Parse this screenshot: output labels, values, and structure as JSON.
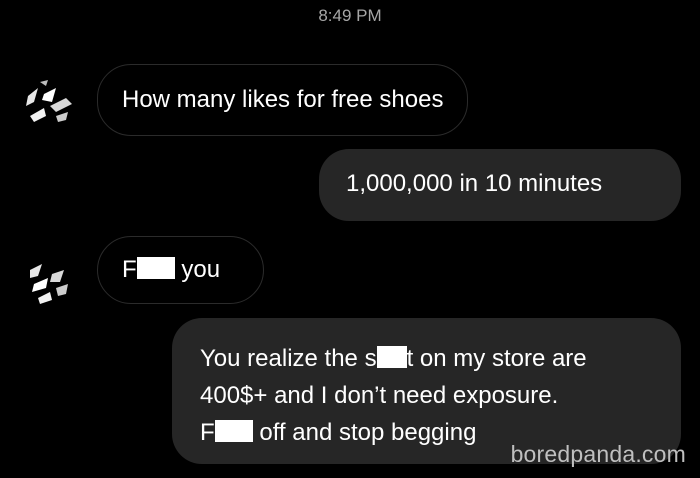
{
  "header": {
    "time": "8:49 PM"
  },
  "messages": [
    {
      "sender": "them",
      "parts": [
        "How many likes for free shoes"
      ]
    },
    {
      "sender": "me",
      "parts": [
        "1,000,000 in 10 minutes"
      ]
    },
    {
      "sender": "them",
      "parts": [
        "F",
        "you"
      ]
    },
    {
      "sender": "me",
      "lines": [
        [
          "You realize the s",
          "t on my store are"
        ],
        [
          "400$+ and I don’t need exposure."
        ],
        [
          "F",
          "off and stop begging"
        ]
      ]
    }
  ],
  "watermark": "boredpanda.com",
  "colors": {
    "background": "#000000",
    "incoming_bubble_border": "#2b2b2b",
    "outgoing_bubble": "#262626",
    "timestamp": "#a6a6a6",
    "censor_bar": "#ffffff"
  },
  "icons": {
    "avatar": "profile-picture-avatar"
  }
}
